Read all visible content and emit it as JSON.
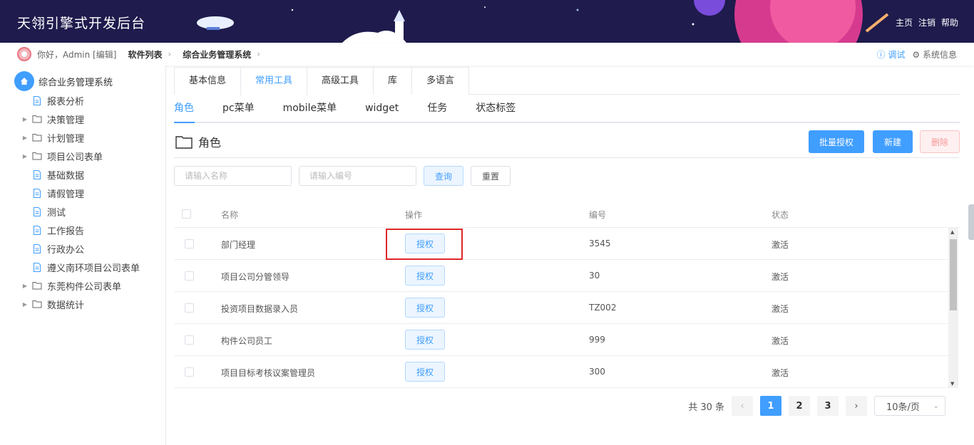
{
  "header": {
    "title": "天翎引擎式开发后台",
    "links": [
      "主页",
      "注销",
      "帮助"
    ]
  },
  "crumbs": {
    "greeting": "你好，Admin [编辑]",
    "items": [
      "软件列表",
      "综合业务管理系统"
    ],
    "debug": "调试",
    "sysinfo": "系统信息"
  },
  "sidebar": {
    "root": "综合业务管理系统",
    "items": [
      {
        "label": "报表分析",
        "type": "doc",
        "expandable": false
      },
      {
        "label": "决策管理",
        "type": "folder",
        "expandable": true
      },
      {
        "label": "计划管理",
        "type": "folder",
        "expandable": true
      },
      {
        "label": "项目公司表单",
        "type": "folder",
        "expandable": true
      },
      {
        "label": "基础数据",
        "type": "doc",
        "expandable": false
      },
      {
        "label": "请假管理",
        "type": "doc",
        "expandable": false
      },
      {
        "label": "测试",
        "type": "doc",
        "expandable": false
      },
      {
        "label": "工作报告",
        "type": "doc",
        "expandable": false
      },
      {
        "label": "行政办公",
        "type": "doc",
        "expandable": false
      },
      {
        "label": "遵义南环项目公司表单",
        "type": "doc",
        "expandable": false
      },
      {
        "label": "东莞构件公司表单",
        "type": "folder",
        "expandable": true
      },
      {
        "label": "数据统计",
        "type": "folder",
        "expandable": true
      }
    ]
  },
  "tabs": {
    "primary": [
      "基本信息",
      "常用工具",
      "高级工具",
      "库",
      "多语言"
    ],
    "primary_active": 1,
    "secondary": [
      "角色",
      "pc菜单",
      "mobile菜单",
      "widget",
      "任务",
      "状态标签"
    ],
    "secondary_active": 0
  },
  "section": {
    "title": "角色",
    "batch_auth": "批量授权",
    "create": "新建",
    "delete": "删除"
  },
  "filters": {
    "name_placeholder": "请输入名称",
    "code_placeholder": "请输入编号",
    "search": "查询",
    "reset": "重置"
  },
  "table": {
    "columns": [
      "名称",
      "操作",
      "编号",
      "状态"
    ],
    "rows": [
      {
        "name": "部门经理",
        "action": "授权",
        "code": "3545",
        "status": "激活"
      },
      {
        "name": "项目公司分管领导",
        "action": "授权",
        "code": "30",
        "status": "激活"
      },
      {
        "name": "投资项目数据录入员",
        "action": "授权",
        "code": "TZ002",
        "status": "激活"
      },
      {
        "name": "构件公司员工",
        "action": "授权",
        "code": "999",
        "status": "激活"
      },
      {
        "name": "项目目标考核议案管理员",
        "action": "授权",
        "code": "300",
        "status": "激活"
      }
    ]
  },
  "pagination": {
    "total": "共 30 条",
    "pages": [
      "1",
      "2",
      "3"
    ],
    "active": "1",
    "page_size": "10条/页"
  },
  "colors": {
    "header_bg": "#1f1b4d",
    "accent": "#409eff",
    "danger_text": "#f89898",
    "highlight_box": "#e0262a"
  }
}
